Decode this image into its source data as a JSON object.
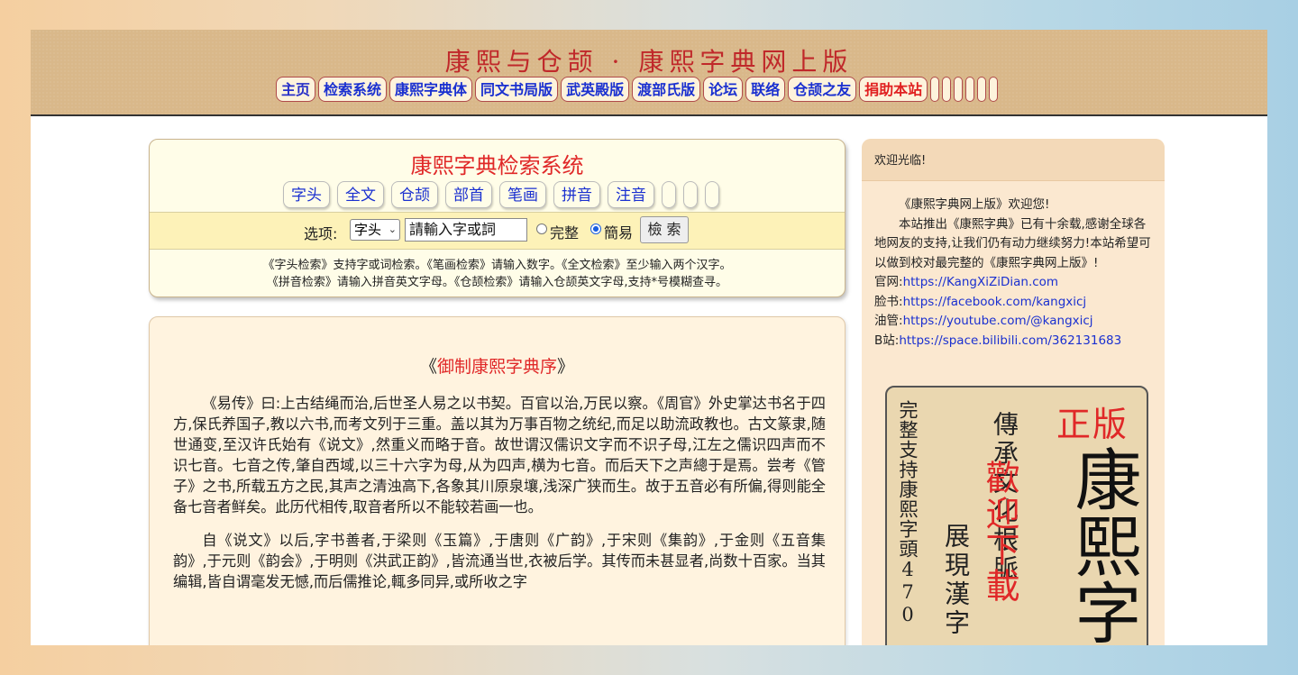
{
  "header": {
    "title": "康熙与仓颉 · 康熙字典网上版",
    "nav": [
      "主页",
      "检索系统",
      "康熙字典体",
      "同文书局版",
      "武英殿版",
      "渡部氏版",
      "论坛",
      "联络",
      "仓颉之友",
      "捐助本站"
    ]
  },
  "search": {
    "title": "康熙字典检索系统",
    "tabs": [
      "字头",
      "全文",
      "仓颉",
      "部首",
      "笔画",
      "拼音",
      "注音"
    ],
    "option_label": "选项:",
    "select_value": "字头",
    "input_value": "請輸入字或詞",
    "radio_full": "完整",
    "radio_simple": "簡易",
    "button": "檢 索",
    "help_1": "《字头检索》支持字或词检索。《笔画检索》请输入数字。《全文检索》至少输入两个汉字。",
    "help_2": "《拼音检索》请输入拼音英文字母。《仓颉检索》请输入仓颉英文字母,支持*号模糊查寻。"
  },
  "preface": {
    "title_open": "《",
    "title": "御制康熙字典序",
    "title_close": "》",
    "para1": "《易传》曰:上古结绳而治,后世圣人易之以书契。百官以治,万民以察。《周官》外史掌达书名于四方,保氏养国子,教以六书,而考文列于三重。盖以其为万事百物之统纪,而足以助流政教也。古文篆隶,随世通变,至汉许氏始有《说文》,然重义而略于音。故世谓汉儒识文字而不识子母,江左之儒识四声而不识七音。七音之传,肇自西域,以三十六字为母,从为四声,横为七音。而后天下之声總于是焉。尝考《管子》之书,所载五方之民,其声之清浊高下,各象其川原泉壤,浅深广狭而生。故于五音必有所偏,得则能全备七音者鲜矣。此历代相传,取音者所以不能较若画一也。",
    "para2": "自《说文》以后,字书善者,于梁则《玉篇》,于唐则《广韵》,于宋则《集韵》,于金则《五音集韵》,于元则《韵会》,于明则《洪武正韵》,皆流通当世,衣被后学。其传而未甚显者,尚数十百家。当其编辑,皆自谓毫发无憾,而后儒推论,輒多同异,或所收之字"
  },
  "sidebar": {
    "welcome": "欢迎光临!",
    "p1": "《康熙字典网上版》欢迎您!",
    "p2": "本站推出《康熙字典》已有十余载,感谢全球各地网友的支持,让我们仍有动力继续努力!本站希望可以做到校对最完整的《康熙字典网上版》!",
    "links": [
      {
        "label": "官网:",
        "url": "https://KangXiZiDian.com"
      },
      {
        "label": "脸书:",
        "url": "https://facebook.com/kangxicj"
      },
      {
        "label": "油管:",
        "url": "https://youtube.com/@kangxicj"
      },
      {
        "label": "B站:",
        "url": "https://space.bilibili.com/362131683"
      }
    ],
    "promo": {
      "col1": "完整支持康熙字頭470",
      "col2": "展現漢字",
      "col3": "傳承文化根脈",
      "col4": "歡迎下載",
      "zhengban": "正版",
      "big": "康熙字"
    }
  }
}
